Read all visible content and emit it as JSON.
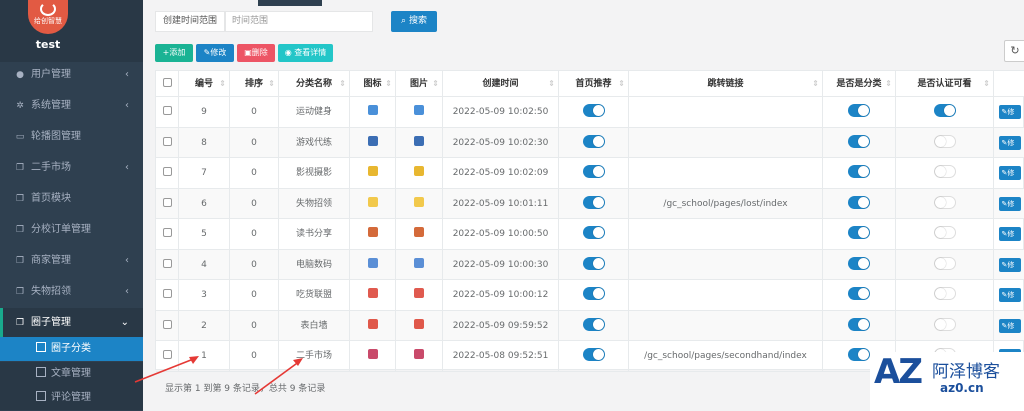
{
  "sidebar": {
    "logo_text": "给创智慧",
    "username": "test",
    "items": [
      {
        "label": "用户管理",
        "icon": "user-icon",
        "has_arrow": true
      },
      {
        "label": "系统管理",
        "icon": "gears-icon",
        "has_arrow": true
      },
      {
        "label": "轮播图管理",
        "icon": "monitor-icon",
        "has_arrow": false
      },
      {
        "label": "二手市场",
        "icon": "copy-icon",
        "has_arrow": true
      },
      {
        "label": "首页模块",
        "icon": "copy-icon",
        "has_arrow": false
      },
      {
        "label": "分校订单管理",
        "icon": "copy-icon",
        "has_arrow": false
      },
      {
        "label": "商家管理",
        "icon": "copy-icon",
        "has_arrow": true
      },
      {
        "label": "失物招领",
        "icon": "copy-icon",
        "has_arrow": true
      },
      {
        "label": "圈子管理",
        "icon": "copy-icon",
        "has_arrow": true
      }
    ],
    "sub_items": [
      {
        "label": "圈子分类",
        "active": true
      },
      {
        "label": "文章管理",
        "active": false
      },
      {
        "label": "评论管理",
        "active": false
      }
    ]
  },
  "search": {
    "label": "创建时间范围",
    "placeholder": "时间范围",
    "button": "搜索"
  },
  "toolbar": {
    "add": "添加",
    "edit": "修改",
    "delete": "删除",
    "view": "查看详情"
  },
  "table": {
    "headers": [
      "编号",
      "排序",
      "分类名称",
      "图标",
      "图片",
      "创建时间",
      "首页推荐",
      "跳转链接",
      "是否是分类",
      "是否认证可看"
    ],
    "edit_label": "修",
    "rows": [
      {
        "id": "9",
        "sort": "0",
        "name": "运动健身",
        "icon_color": "#4a90d9",
        "created": "2022-05-09 10:02:50",
        "home": true,
        "link": "",
        "is_cat": true,
        "auth": true
      },
      {
        "id": "8",
        "sort": "0",
        "name": "游戏代练",
        "icon_color": "#3c6eb4",
        "created": "2022-05-09 10:02:30",
        "home": true,
        "link": "",
        "is_cat": true,
        "auth": false
      },
      {
        "id": "7",
        "sort": "0",
        "name": "影视摄影",
        "icon_color": "#e8b730",
        "created": "2022-05-09 10:02:09",
        "home": true,
        "link": "",
        "is_cat": true,
        "auth": false
      },
      {
        "id": "6",
        "sort": "0",
        "name": "失物招领",
        "icon_color": "#f2c94c",
        "created": "2022-05-09 10:01:11",
        "home": true,
        "link": "/gc_school/pages/lost/index",
        "is_cat": true,
        "auth": false
      },
      {
        "id": "5",
        "sort": "0",
        "name": "读书分享",
        "icon_color": "#d46a3a",
        "created": "2022-05-09 10:00:50",
        "home": true,
        "link": "",
        "is_cat": true,
        "auth": false
      },
      {
        "id": "4",
        "sort": "0",
        "name": "电脑数码",
        "icon_color": "#5b8fd6",
        "created": "2022-05-09 10:00:30",
        "home": true,
        "link": "",
        "is_cat": true,
        "auth": false
      },
      {
        "id": "3",
        "sort": "0",
        "name": "吃货联盟",
        "icon_color": "#e05a4f",
        "created": "2022-05-09 10:00:12",
        "home": true,
        "link": "",
        "is_cat": true,
        "auth": false
      },
      {
        "id": "2",
        "sort": "0",
        "name": "表白墙",
        "icon_color": "#e0584a",
        "created": "2022-05-09 09:59:52",
        "home": true,
        "link": "",
        "is_cat": true,
        "auth": false
      },
      {
        "id": "1",
        "sort": "0",
        "name": "二手市场",
        "icon_color": "#c94a6a",
        "created": "2022-05-08 09:52:51",
        "home": true,
        "link": "/gc_school/pages/secondhand/index",
        "is_cat": true,
        "auth": false
      }
    ]
  },
  "pager": "显示第 1 到第 9 条记录，总共 9 条记录",
  "watermark": {
    "az": "AZ",
    "cn": "阿泽博客",
    "url": "az0.cn"
  },
  "colors": {
    "sidebar": "#2f4050",
    "primary": "#1c84c6",
    "success": "#1ab394",
    "danger": "#ed5565",
    "info": "#23c6c8"
  }
}
